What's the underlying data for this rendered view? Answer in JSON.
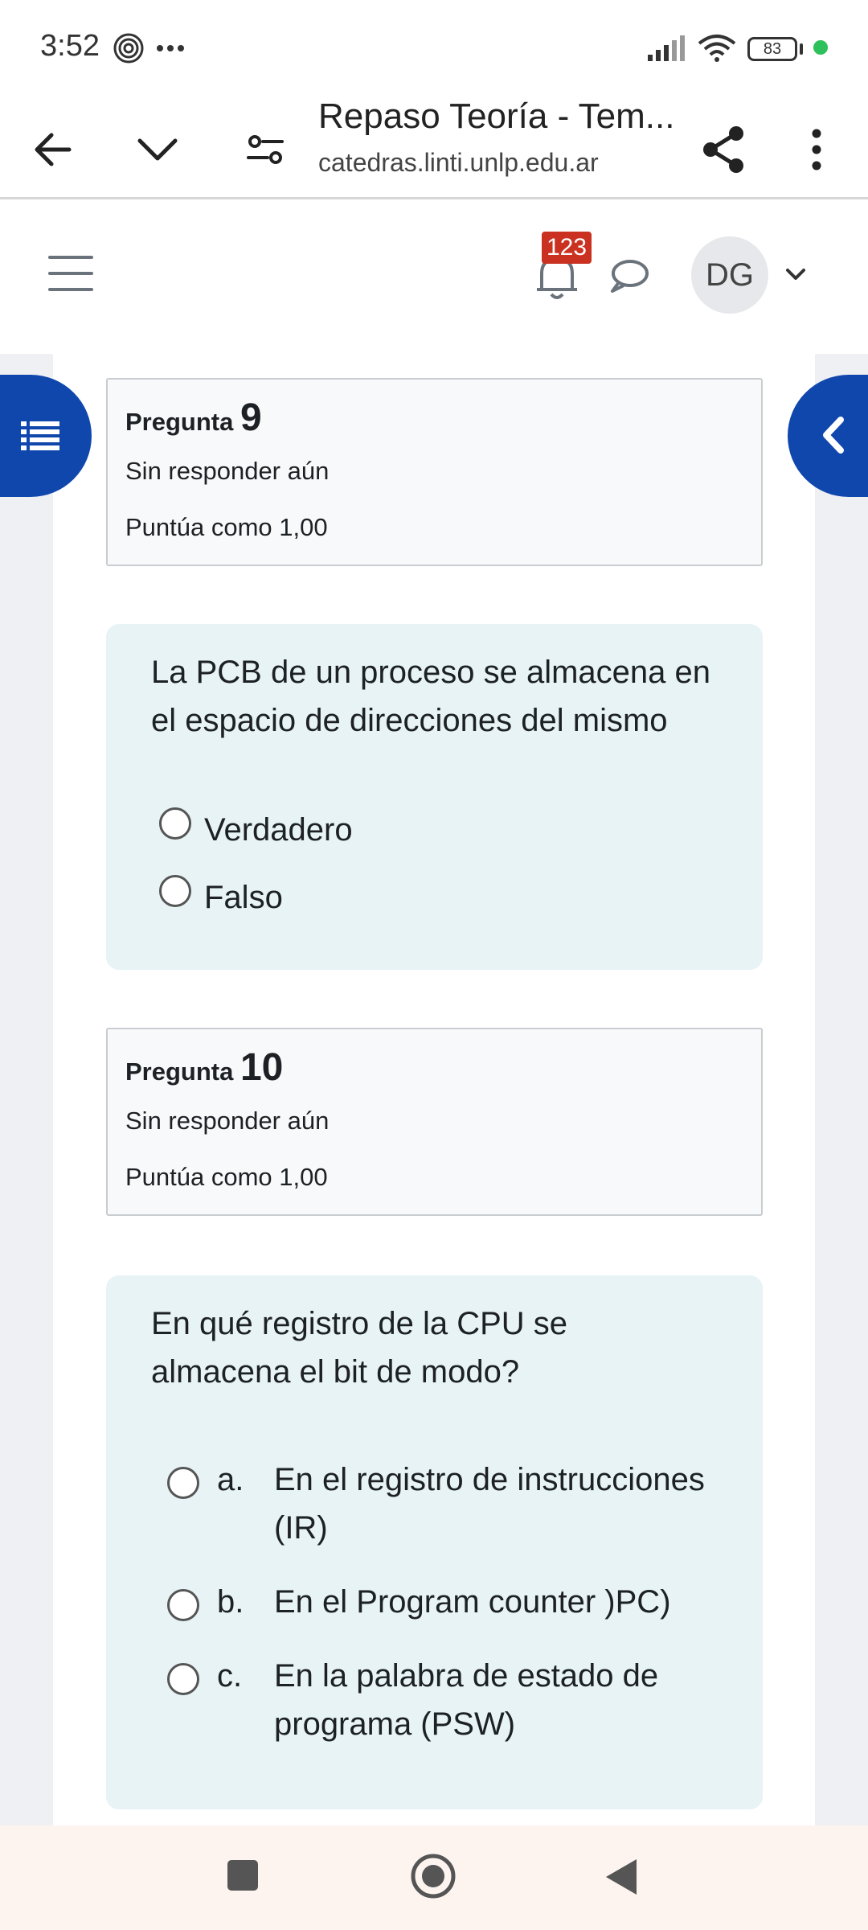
{
  "status_bar": {
    "time": "3:52",
    "battery": "83",
    "icons": [
      "fingerprint-icon",
      "more-dots-icon",
      "signal-icon",
      "wifi-icon",
      "battery-icon"
    ]
  },
  "browser": {
    "title": "Repaso Teoría - Tem...",
    "url": "catedras.linti.unlp.edu.ar"
  },
  "header": {
    "notification_count": "123",
    "avatar_initials": "DG"
  },
  "questions": [
    {
      "label": "Pregunta",
      "number": "9",
      "state": "Sin responder aún",
      "grade": "Puntúa como 1,00",
      "text": "La PCB de un proceso se almacena en el espacio de direcciones del mismo",
      "options": [
        {
          "letter": "",
          "text": "Verdadero"
        },
        {
          "letter": "",
          "text": "Falso"
        }
      ]
    },
    {
      "label": "Pregunta",
      "number": "10",
      "state": "Sin responder aún",
      "grade": "Puntúa como 1,00",
      "text": "En qué registro de la CPU se almacena el bit de modo?",
      "options": [
        {
          "letter": "a.",
          "text": "En el registro de instrucciones (IR)"
        },
        {
          "letter": "b.",
          "text": "En el Program counter )PC)"
        },
        {
          "letter": "c.",
          "text": "En la palabra de estado de programa (PSW)"
        }
      ]
    }
  ],
  "colors": {
    "brand": "#0f47ad",
    "badge": "#ca3120",
    "question_bg": "#e7f3f5",
    "info_bg": "#f8f9fa"
  }
}
